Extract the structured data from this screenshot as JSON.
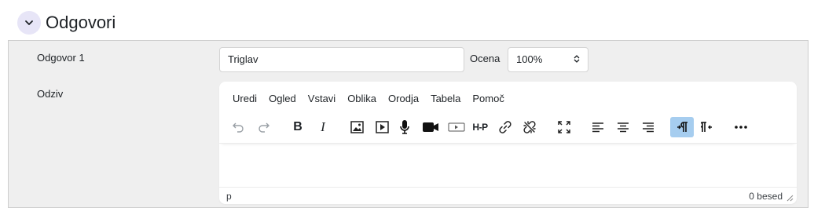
{
  "section": {
    "title": "Odgovori"
  },
  "answer": {
    "label": "Odgovor 1",
    "value": "Triglav",
    "grade_label": "Ocena",
    "grade_value": "100%"
  },
  "feedback": {
    "label": "Odziv",
    "menu": [
      "Uredi",
      "Ogled",
      "Vstavi",
      "Oblika",
      "Orodja",
      "Tabela",
      "Pomoč"
    ],
    "toolbar_icons": [
      "undo-icon",
      "redo-icon",
      "bold-icon",
      "italic-icon",
      "image-icon",
      "media-icon",
      "microphone-icon",
      "video-camera-icon",
      "video-file-icon",
      "h5p-icon",
      "link-icon",
      "unlink-icon",
      "fullscreen-icon",
      "align-left-icon",
      "align-center-icon",
      "align-right-icon",
      "ltr-icon",
      "rtl-icon",
      "more-icon"
    ],
    "toolbar_text": {
      "bold": "B",
      "italic": "I",
      "h5p": "H-P"
    },
    "status_path": "p",
    "word_count": "0 besed"
  },
  "colors": {
    "accent_bg": "#e7e5f7",
    "active_button": "#a6cdef",
    "panel_bg": "#efefef"
  }
}
